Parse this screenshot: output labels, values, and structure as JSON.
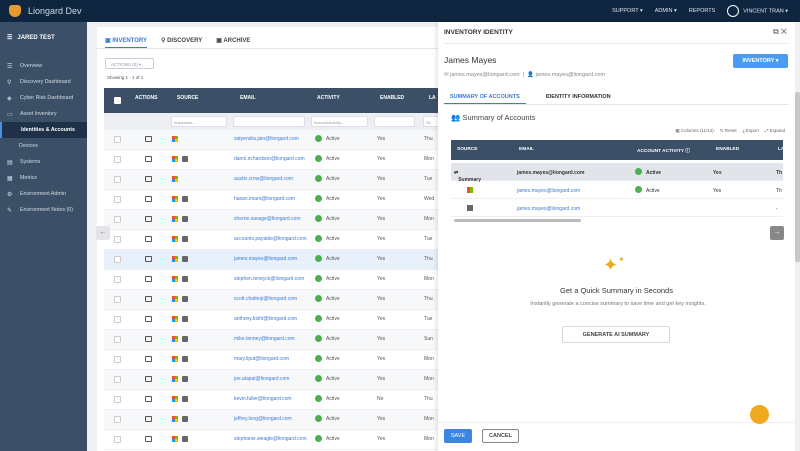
{
  "app": {
    "title": "Liongard Dev",
    "nav": [
      "SUPPORT ▾",
      "ADMIN ▾",
      "REPORTS"
    ],
    "user": "VINCENT TRAN ▾"
  },
  "sidebar": {
    "org": "JARED TEST",
    "items": [
      {
        "label": "Overview",
        "icon": "☰"
      },
      {
        "label": "Discovery Dashboard",
        "icon": "⚲"
      },
      {
        "label": "Cyber Risk Dashboard",
        "icon": "◈"
      },
      {
        "label": "Asset Inventory",
        "icon": "▭"
      },
      {
        "label": "Identities & Accounts",
        "sub": true,
        "active": true
      },
      {
        "label": "Devices",
        "sub": true
      },
      {
        "label": "Systems",
        "icon": "▤"
      },
      {
        "label": "Metrics",
        "icon": "▦"
      },
      {
        "label": "Environment Admin",
        "icon": "⚙"
      },
      {
        "label": "Environment Notes (0)",
        "icon": "✎"
      }
    ]
  },
  "main": {
    "tabs": [
      "INVENTORY",
      "DISCOVERY",
      "ARCHIVE"
    ],
    "actions": "ACTIONS (0) ▾",
    "showing": "Showing 1 - 1 of 1",
    "columns": [
      "ACTIONS",
      "SOURCE",
      "EMAIL",
      "ACTIVITY",
      "ENABLED",
      "LA"
    ],
    "filters": [
      "Inspectors...",
      "",
      "AccountActivity...",
      "",
      "Se"
    ],
    "rows": [
      {
        "email": "satyendra.jain@liongard.com",
        "activity": "Active",
        "enabled": "Yes",
        "last": "Thu",
        "ad": false
      },
      {
        "email": "danni.richardson@liongard.com",
        "activity": "Active",
        "enabled": "Yes",
        "last": "Mon",
        "ad": true
      },
      {
        "email": "austin.crow@liongard.com",
        "activity": "Active",
        "enabled": "Yes",
        "last": "Tue",
        "ad": false
      },
      {
        "email": "hasan.imam@liongard.com",
        "activity": "Active",
        "enabled": "Yes",
        "last": "Wed",
        "ad": true
      },
      {
        "email": "sherrie.savage@liongard.com",
        "activity": "Active",
        "enabled": "Yes",
        "last": "Mon",
        "ad": true
      },
      {
        "email": "accounts.payable@liongard.com",
        "activity": "Active",
        "enabled": "Yes",
        "last": "Tue",
        "ad": true
      },
      {
        "email": "james.mayes@liongard.com",
        "activity": "Active",
        "enabled": "Yes",
        "last": "Thu",
        "ad": true,
        "selected": true
      },
      {
        "email": "stephen.teneyck@liongard.com",
        "activity": "Active",
        "enabled": "Yes",
        "last": "Mon",
        "ad": true
      },
      {
        "email": "scott.chatterji@liongard.com",
        "activity": "Active",
        "enabled": "Yes",
        "last": "Thu",
        "ad": true
      },
      {
        "email": "anthony.bisht@liongard.com",
        "activity": "Active",
        "enabled": "Yes",
        "last": "Tue",
        "ad": true
      },
      {
        "email": "mike.tenney@liongard.com",
        "activity": "Active",
        "enabled": "Yes",
        "last": "Sun",
        "ad": true
      },
      {
        "email": "mary.liput@liongard.com",
        "activity": "Active",
        "enabled": "Yes",
        "last": "Mon",
        "ad": true
      },
      {
        "email": "joe.alapat@liongard.com",
        "activity": "Active",
        "enabled": "Yes",
        "last": "Mon",
        "ad": true
      },
      {
        "email": "kevin.fuller@liongard.com",
        "activity": "Active",
        "enabled": "No",
        "last": "Thu",
        "ad": true
      },
      {
        "email": "jeffrey.long@liongard.com",
        "activity": "Active",
        "enabled": "Yes",
        "last": "Mon",
        "ad": true
      },
      {
        "email": "stephanie.weagle@liongard.com",
        "activity": "Active",
        "enabled": "Yes",
        "last": "Mon",
        "ad": true
      }
    ]
  },
  "panel": {
    "title": "INVENTORY IDENTITY",
    "name": "James Mayes",
    "inventory_btn": "INVENTORY ▾",
    "email": "james.mayes@liongard.com",
    "username": "james.mayes@liongard.com",
    "tabs": [
      "SUMMARY OF ACCOUNTS",
      "IDENTITY INFORMATION"
    ],
    "section": "Summary of Accounts",
    "tools": [
      "Columns (11/14)",
      "Reset",
      "Export",
      "Expand"
    ],
    "columns": [
      "SOURCE",
      "EMAIL",
      "ACCOUNT ACTIVITY ⓘ",
      "ENABLED",
      "LA"
    ],
    "rows": [
      {
        "source": "Summary",
        "email": "james.mayes@liongard.com",
        "activity": "Active",
        "enabled": "Yes",
        "last": "Th"
      },
      {
        "source": "",
        "email": "james.mayes@liongard.com",
        "activity": "Active",
        "enabled": "Yes",
        "last": "Th"
      },
      {
        "source": "",
        "email": "james.mayes@liongard.com",
        "activity": "",
        "enabled": "",
        "last": "-"
      }
    ],
    "ai_title": "Get a Quick Summary in Seconds",
    "ai_desc": "Instantly generate a concise summary to save time and get key insights.",
    "ai_btn": "GENERATE AI SUMMARY",
    "save": "SAVE",
    "cancel": "CANCEL"
  },
  "colors": {
    "accent": "#3a7bd5",
    "nav": "#0f2640",
    "sidebar": "#3b4f67",
    "star": "#f0a81c"
  }
}
